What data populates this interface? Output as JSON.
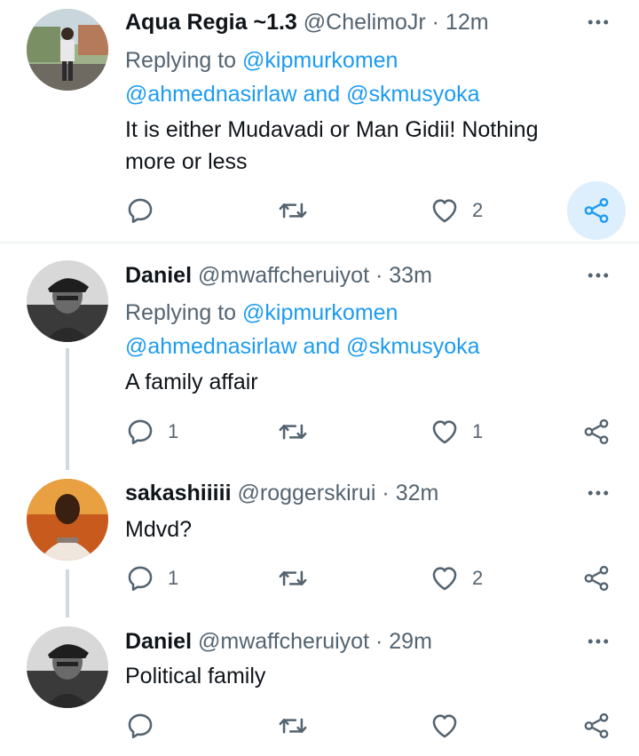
{
  "tweets": [
    {
      "name": "Aqua Regia ~1.3",
      "handle": "@ChelimoJr",
      "sep": "·",
      "time": "12m",
      "replying_prefix": "Replying to",
      "replying_user": "@kipmurkomen",
      "replying_line2_a": "@ahmednasirlaw",
      "replying_and": "and",
      "replying_line2_b": "@skmusyoka",
      "text_line1": "It is either Mudavadi or Man Gidii! Nothing",
      "text_line2": "more or less",
      "reply_count": "",
      "retweet_count": "",
      "like_count": "2"
    },
    {
      "name": "Daniel",
      "handle": "@mwaffcheruiyot",
      "sep": "·",
      "time": "33m",
      "replying_prefix": "Replying to",
      "replying_user": "@kipmurkomen",
      "replying_line2_a": "@ahmednasirlaw",
      "replying_and": "and",
      "replying_line2_b": "@skmusyoka",
      "text_line1": "A family affair",
      "reply_count": "1",
      "retweet_count": "",
      "like_count": "1"
    },
    {
      "name": "sakashiiiii",
      "handle": "@roggerskirui",
      "sep": "·",
      "time": "32m",
      "text_line1": "Mdvd?",
      "reply_count": "1",
      "retweet_count": "",
      "like_count": "2"
    },
    {
      "name": "Daniel",
      "handle": "@mwaffcheruiyot",
      "sep": "·",
      "time": "29m",
      "text_line1": "Political family",
      "reply_count": "",
      "retweet_count": "",
      "like_count": ""
    }
  ],
  "colors": {
    "link": "#1d9bf0",
    "secondary": "#536471",
    "share_highlight": "#ddeefc",
    "thread_line": "#cfd9de"
  },
  "icons": [
    "reply-icon",
    "retweet-icon",
    "like-icon",
    "share-icon",
    "more-icon"
  ]
}
